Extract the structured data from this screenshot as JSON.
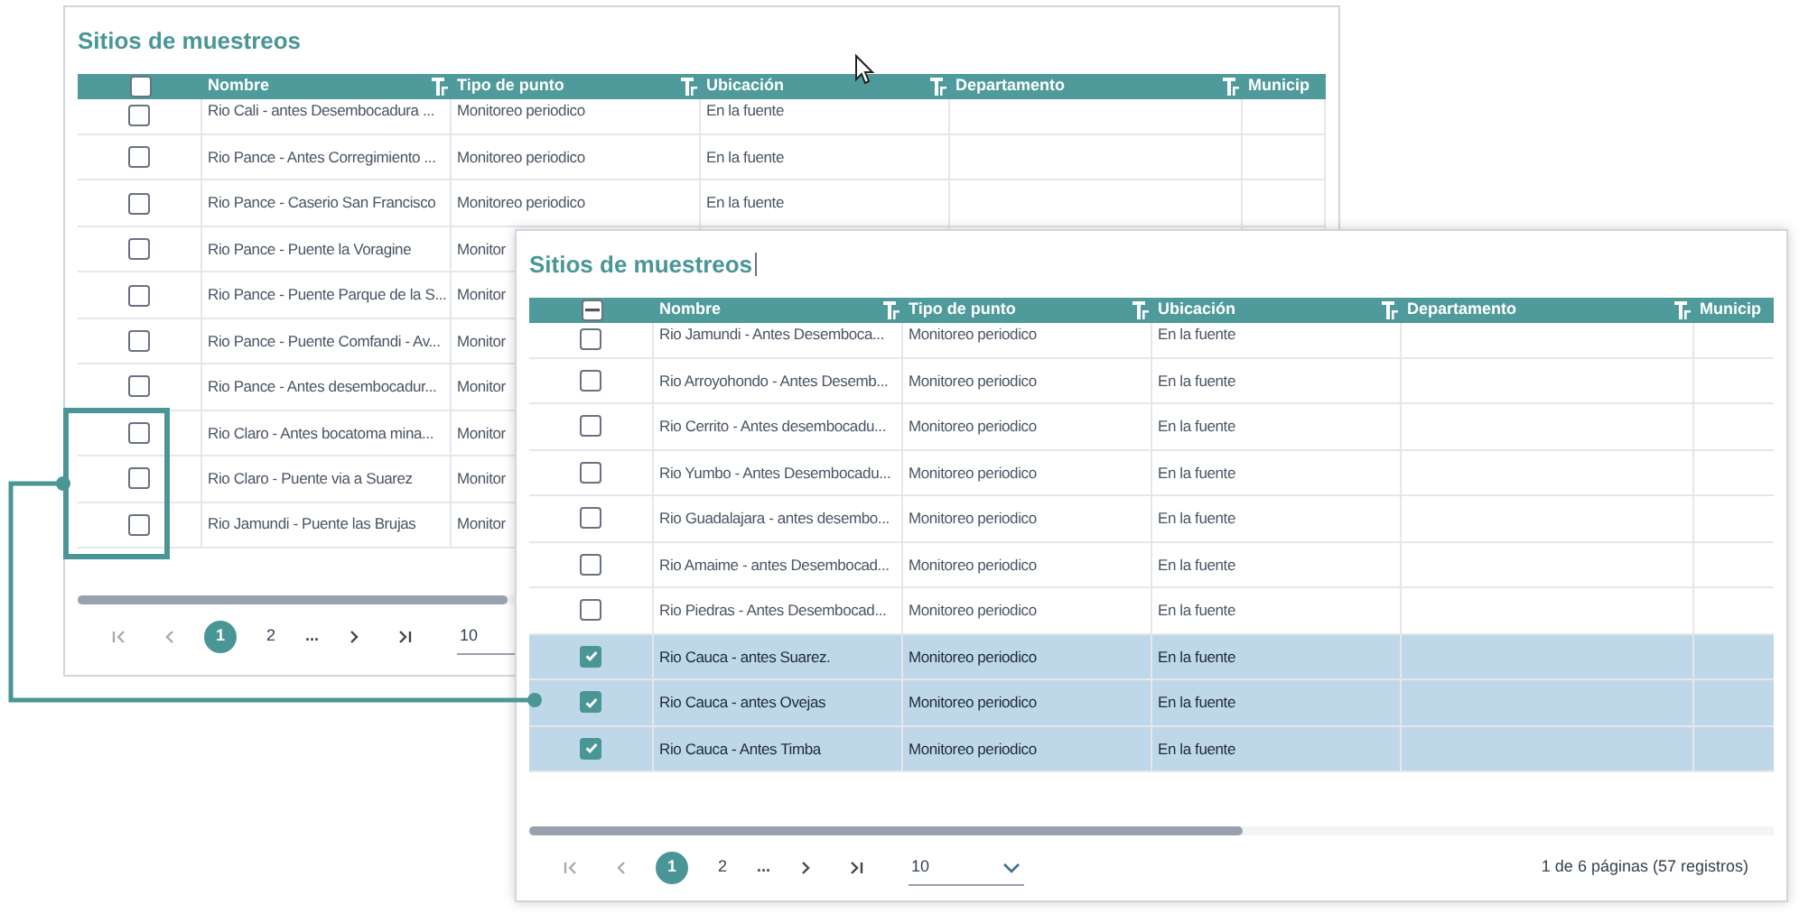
{
  "panels": [
    {
      "title": "Sitios de muestreos",
      "header_indeterminate": false,
      "columns": [
        "Nombre",
        "Tipo de punto",
        "Ubicación",
        "Departamento",
        "Municip"
      ],
      "rows": [
        {
          "nombre": "Rio Cali - antes Desembocadura ...",
          "tipo": "Monitoreo periodico",
          "ubicacion": "En la fuente",
          "selected": false
        },
        {
          "nombre": "Rio Pance - Antes Corregimiento ...",
          "tipo": "Monitoreo periodico",
          "ubicacion": "En la fuente",
          "selected": false
        },
        {
          "nombre": "Rio Pance - Caserio San Francisco",
          "tipo": "Monitoreo periodico",
          "ubicacion": "En la fuente",
          "selected": false
        },
        {
          "nombre": "Rio Pance - Puente la Voragine",
          "tipo": "Monitor",
          "selected": false
        },
        {
          "nombre": "Rio Pance - Puente Parque de la S...",
          "tipo": "Monitor",
          "selected": false
        },
        {
          "nombre": "Rio Pance - Puente Comfandi - Av...",
          "tipo": "Monitor",
          "selected": false
        },
        {
          "nombre": "Rio Pance - Antes desembocadur...",
          "tipo": "Monitor",
          "selected": false
        },
        {
          "nombre": "Rio Claro - Antes bocatoma mina...",
          "tipo": "Monitor",
          "selected": false
        },
        {
          "nombre": "Rio Claro - Puente via a Suarez",
          "tipo": "Monitor",
          "selected": false
        },
        {
          "nombre": "Rio Jamundi - Puente las Brujas",
          "tipo": "Monitor",
          "selected": false
        }
      ],
      "pagination": {
        "pages": [
          {
            "label": "1",
            "selected": true
          },
          {
            "label": "2",
            "selected": false
          }
        ],
        "ellipsis": "...",
        "page_size": "10"
      }
    },
    {
      "title": "Sitios de muestreos",
      "header_indeterminate": true,
      "columns": [
        "Nombre",
        "Tipo de punto",
        "Ubicación",
        "Departamento",
        "Municip"
      ],
      "rows": [
        {
          "nombre": "Rio Jamundi - Antes Desemboca...",
          "tipo": "Monitoreo periodico",
          "ubicacion": "En la fuente",
          "selected": false
        },
        {
          "nombre": "Rio Arroyohondo - Antes Desemb...",
          "tipo": "Monitoreo periodico",
          "ubicacion": "En la fuente",
          "selected": false
        },
        {
          "nombre": "Rio Cerrito - Antes desembocadu...",
          "tipo": "Monitoreo periodico",
          "ubicacion": "En la fuente",
          "selected": false
        },
        {
          "nombre": "Rio Yumbo - Antes Desembocadu...",
          "tipo": "Monitoreo periodico",
          "ubicacion": "En la fuente",
          "selected": false
        },
        {
          "nombre": "Rio Guadalajara - antes desembo...",
          "tipo": "Monitoreo periodico",
          "ubicacion": "En la fuente",
          "selected": false
        },
        {
          "nombre": "Rio Amaime - antes Desembocad...",
          "tipo": "Monitoreo periodico",
          "ubicacion": "En la fuente",
          "selected": false
        },
        {
          "nombre": "Rio Piedras - Antes Desembocad...",
          "tipo": "Monitoreo periodico",
          "ubicacion": "En la fuente",
          "selected": false
        },
        {
          "nombre": "Rio Cauca - antes Suarez.",
          "tipo": "Monitoreo periodico",
          "ubicacion": "En la fuente",
          "selected": true
        },
        {
          "nombre": "Rio Cauca - antes Ovejas",
          "tipo": "Monitoreo periodico",
          "ubicacion": "En la fuente",
          "selected": true
        },
        {
          "nombre": "Rio Cauca - Antes Timba",
          "tipo": "Monitoreo periodico",
          "ubicacion": "En la fuente",
          "selected": true
        }
      ],
      "pagination": {
        "pages": [
          {
            "label": "1",
            "selected": true
          },
          {
            "label": "2",
            "selected": false
          }
        ],
        "ellipsis": "...",
        "page_size": "10",
        "summary": "1 de 6 páginas (57 registros)"
      }
    }
  ]
}
